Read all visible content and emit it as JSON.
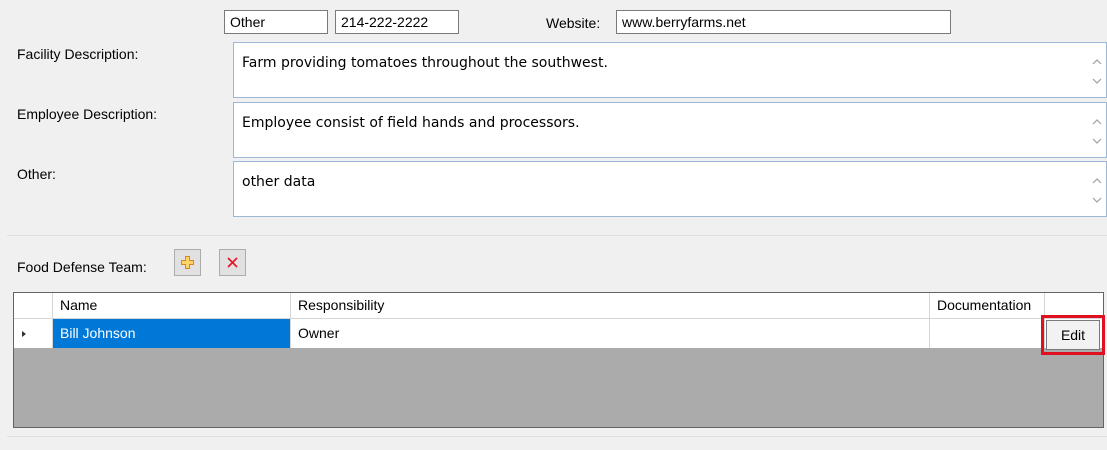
{
  "contact": {
    "type_value": "Other",
    "phone_value": "214-222-2222",
    "website_label": "Website:",
    "website_value": "www.berryfarms.net"
  },
  "facility": {
    "label": "Facility Description:",
    "value": "Farm providing tomatoes throughout the southwest."
  },
  "employee": {
    "label": "Employee Description:",
    "value": "Employee consist of field hands and processors."
  },
  "other": {
    "label": "Other:",
    "value": "other data"
  },
  "team": {
    "label": "Food Defense Team:",
    "add_icon": "plus-icon",
    "delete_icon": "x-icon",
    "columns": [
      "Name",
      "Responsibility",
      "Documentation"
    ],
    "rows": [
      {
        "name": "Bill Johnson",
        "responsibility": "Owner",
        "documentation": "",
        "action": "Edit"
      }
    ]
  },
  "colors": {
    "selection": "#0078d7",
    "highlight_border": "#e0101e",
    "add_icon": "#f2a51c",
    "delete_icon": "#e81123",
    "grid_background": "#ababab"
  }
}
